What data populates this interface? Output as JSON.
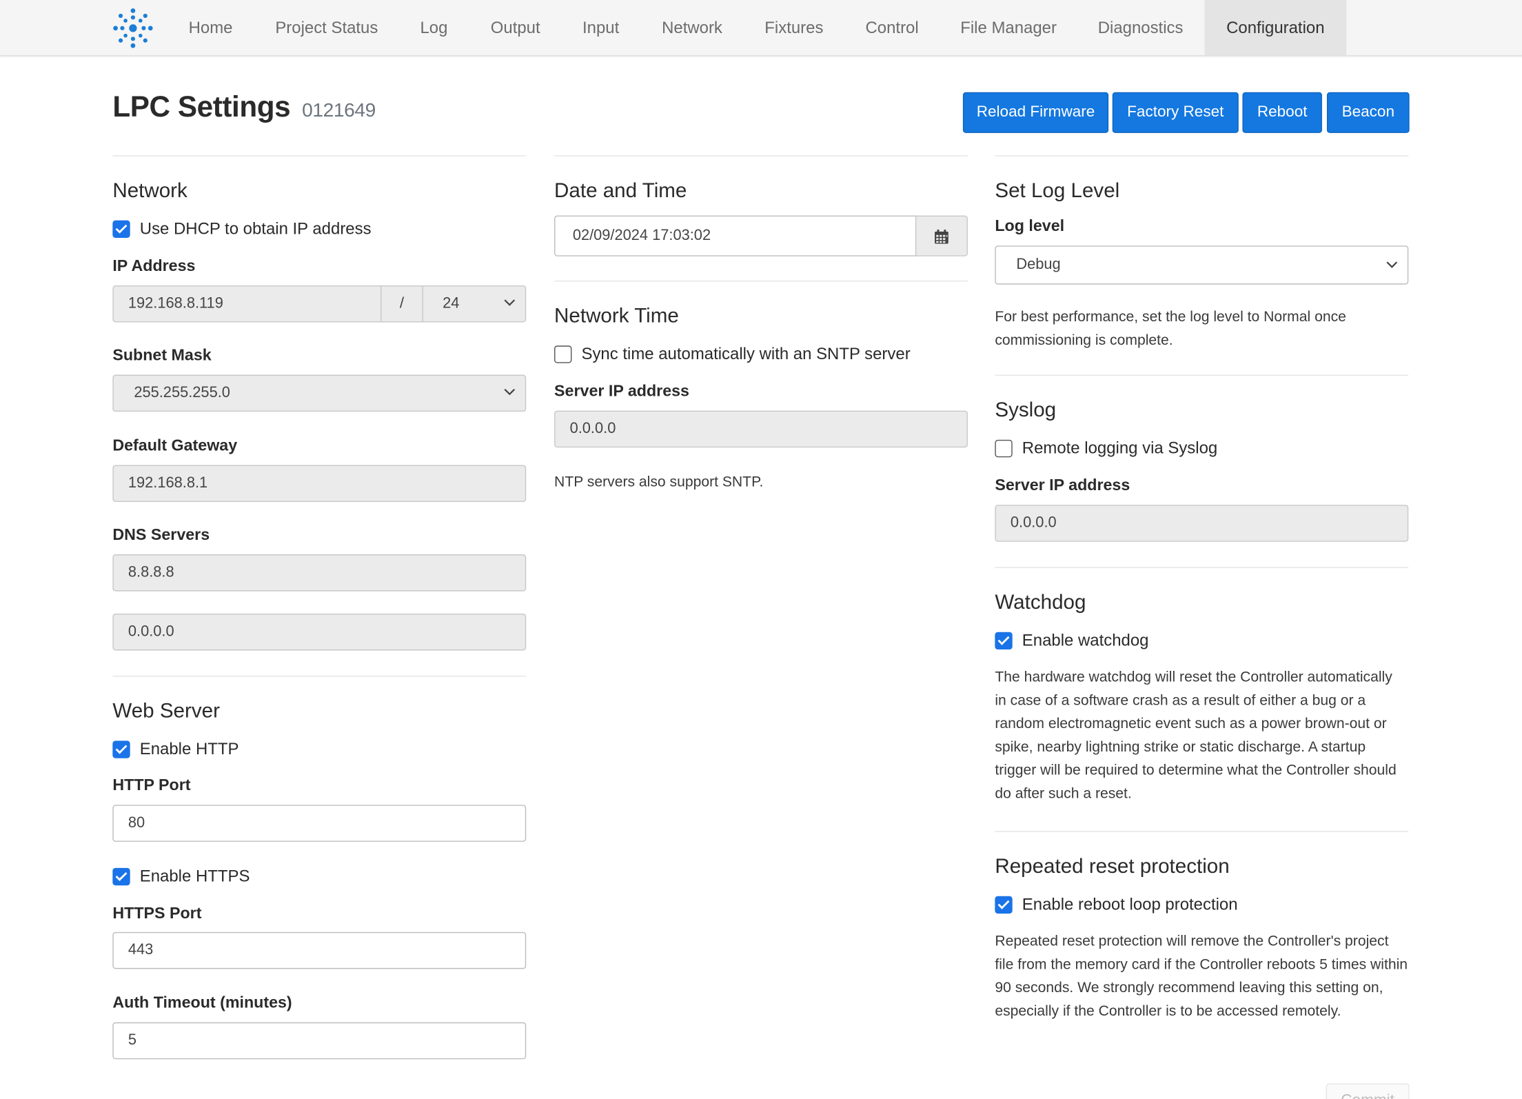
{
  "nav": {
    "items": [
      "Home",
      "Project Status",
      "Log",
      "Output",
      "Input",
      "Network",
      "Fixtures",
      "Control",
      "File Manager",
      "Diagnostics",
      "Configuration"
    ],
    "active": "Configuration"
  },
  "header": {
    "title": "LPC Settings",
    "serial": "0121649",
    "buttons": [
      "Reload Firmware",
      "Factory Reset",
      "Reboot",
      "Beacon"
    ]
  },
  "network": {
    "heading": "Network",
    "dhcp_label": "Use DHCP to obtain IP address",
    "dhcp_checked": true,
    "ip_label": "IP Address",
    "ip_value": "192.168.8.119",
    "ip_separator": "/",
    "prefix_value": "24",
    "subnet_label": "Subnet Mask",
    "subnet_value": "255.255.255.0",
    "gateway_label": "Default Gateway",
    "gateway_value": "192.168.8.1",
    "dns_label": "DNS Servers",
    "dns_primary": "8.8.8.8",
    "dns_secondary": "0.0.0.0"
  },
  "web_server": {
    "heading": "Web Server",
    "http_label": "Enable HTTP",
    "http_checked": true,
    "http_port_label": "HTTP Port",
    "http_port_value": "80",
    "https_label": "Enable HTTPS",
    "https_checked": true,
    "https_port_label": "HTTPS Port",
    "https_port_value": "443",
    "auth_label": "Auth Timeout (minutes)",
    "auth_value": "5"
  },
  "date_time": {
    "heading": "Date and Time",
    "value": "02/09/2024 17:03:02",
    "calendar_icon": "calendar-icon"
  },
  "network_time": {
    "heading": "Network Time",
    "sntp_label": "Sync time automatically with an SNTP server",
    "sntp_checked": false,
    "server_label": "Server IP address",
    "server_value": "0.0.0.0",
    "note": "NTP servers also support SNTP."
  },
  "log_level": {
    "heading": "Set Log Level",
    "label": "Log level",
    "value": "Debug",
    "note": "For best performance, set the log level to Normal once commissioning is complete."
  },
  "syslog": {
    "heading": "Syslog",
    "remote_label": "Remote logging via Syslog",
    "remote_checked": false,
    "server_label": "Server IP address",
    "server_value": "0.0.0.0"
  },
  "watchdog": {
    "heading": "Watchdog",
    "enable_label": "Enable watchdog",
    "enable_checked": true,
    "note": "The hardware watchdog will reset the Controller automatically in case of a software crash as a result of either a bug or a random electromagnetic event such as a power brown-out or spike, nearby lightning strike or static discharge. A startup trigger will be required to determine what the Controller should do after such a reset."
  },
  "reset_protection": {
    "heading": "Repeated reset protection",
    "enable_label": "Enable reboot loop protection",
    "enable_checked": true,
    "note": "Repeated reset protection will remove the Controller's project file from the memory card if the Controller reboots 5 times within 90 seconds. We strongly recommend leaving this setting on, especially if the Controller is to be accessed remotely."
  },
  "commit_label": "Commit",
  "colors": {
    "accent": "#1478e0",
    "nav_bg": "#f5f5f5",
    "readonly_bg": "#ebebeb"
  }
}
